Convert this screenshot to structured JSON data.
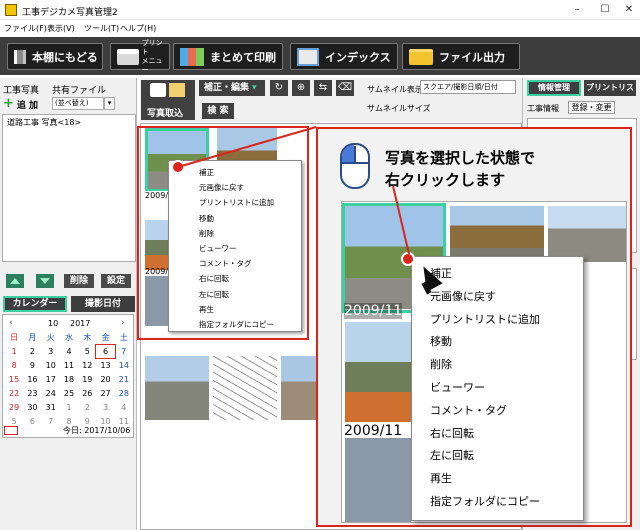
{
  "window": {
    "title": "工事デジカメ写真管理2",
    "controls": [
      "–",
      "☐",
      "✕"
    ]
  },
  "menubar": [
    "ファイル(F)",
    "表示(V)",
    "ツール(T)",
    "ヘルプ(H)"
  ],
  "toolbar": {
    "back_label": "本棚にもどる",
    "print_menu_line1": "プリント",
    "print_menu_line2": "メニュー",
    "batch_print_label": "まとめて印刷",
    "index_label": "インデックス",
    "file_output_label": "ファイル出力"
  },
  "left": {
    "tab_photos": "工事写真",
    "tab_shared": "共有ファイル",
    "add_label": "追 加",
    "sort_value": "(並べ替え)",
    "tree_node": "道路工事 写真<18>",
    "delete_label": "削除",
    "settings_label": "設定",
    "calendar_tab": "カレンダー",
    "date_taken_tab": "撮影日付"
  },
  "calendar": {
    "month": "10",
    "year": "2017",
    "prev": "‹",
    "next": "›",
    "weekdays": [
      "日",
      "月",
      "火",
      "水",
      "木",
      "金",
      "土"
    ],
    "days": [
      [
        "1",
        "2",
        "3",
        "4",
        "5",
        "6",
        "7"
      ],
      [
        "8",
        "9",
        "10",
        "11",
        "12",
        "13",
        "14"
      ],
      [
        "15",
        "16",
        "17",
        "18",
        "19",
        "20",
        "21"
      ],
      [
        "22",
        "23",
        "24",
        "25",
        "26",
        "27",
        "28"
      ],
      [
        "29",
        "30",
        "31",
        "1",
        "2",
        "3",
        "4"
      ],
      [
        "5",
        "6",
        "7",
        "8",
        "9",
        "10",
        "11"
      ]
    ],
    "today_label": "今日: 2017/10/06",
    "today_day": "6"
  },
  "center": {
    "import_label": "写真取込",
    "edit_label": "補正・編集",
    "search_label": "検 索",
    "thumb_display_label": "サムネイル表示",
    "thumb_display_value": "スクエア/撮影日順/日付",
    "thumb_size_label": "サムネイルサイズ",
    "photo_date_caption": "2009/11"
  },
  "right": {
    "tab_info": "情報管理",
    "tab_printlist": "プリントリスト",
    "photo_info_label": "工事情報",
    "register_label": "登録・変更",
    "change_label": "変更"
  },
  "context_menu": [
    "補正",
    "元画像に戻す",
    "プリントリストに追加",
    "移動",
    "削除",
    "ビューワー",
    "コメント・タグ",
    "右に回転",
    "左に回転",
    "再生",
    "指定フォルダにコピー"
  ],
  "callout": {
    "line1": "写真を選択した状態で",
    "line2": "右クリックします",
    "photo_date": "2009/11"
  },
  "colors": {
    "accent_teal": "#3ad0a0",
    "highlight_red": "#d9261c",
    "toolbar_dark": "#3d3d3d"
  }
}
